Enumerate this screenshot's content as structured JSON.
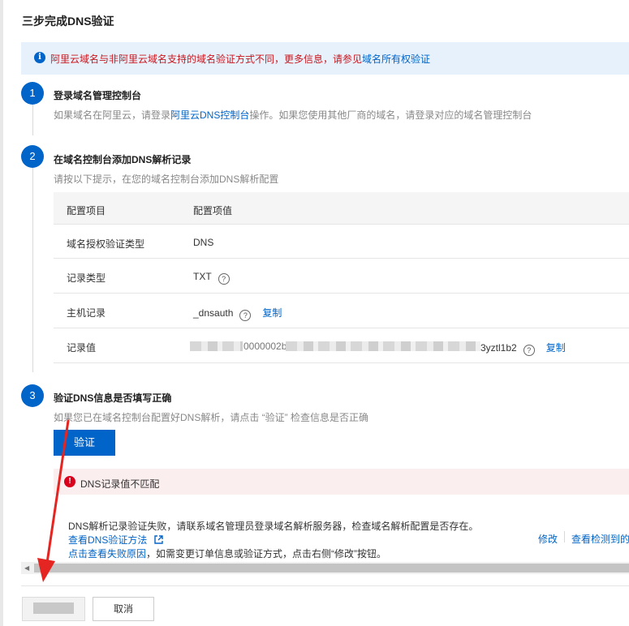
{
  "dialog": {
    "title": "三步完成DNS验证"
  },
  "notice": {
    "text": "阿里云域名与非阿里云域名支持的域名验证方式不同，更多信息，请参见",
    "link": "域名所有权验证"
  },
  "steps": [
    {
      "number": "1",
      "title": "登录域名管理控制台",
      "desc_prefix": "如果域名在阿里云，请登录",
      "desc_link": "阿里云DNS控制台",
      "desc_suffix": "操作。如果您使用其他厂商的域名，请登录对应的域名管理控制台"
    },
    {
      "number": "2",
      "title": "在域名控制台添加DNS解析记录",
      "desc": "请按以下提示，在您的域名控制台添加DNS解析配置"
    },
    {
      "number": "3",
      "title": "验证DNS信息是否填写正确",
      "desc": "如果您已在域名控制台配置好DNS解析，请点击 “验证” 检查信息是否正确"
    }
  ],
  "table": {
    "headers": [
      "配置项目",
      "配置项值"
    ],
    "rows": [
      {
        "label": "域名授权验证类型",
        "value": "DNS"
      },
      {
        "label": "记录类型",
        "value": "TXT"
      },
      {
        "label": "主机记录",
        "value": "_dnsauth",
        "action": "复制"
      },
      {
        "label": "记录值",
        "value_visible_start": "0000002b",
        "value_visible_end": "3yztl1b2",
        "action": "复制"
      }
    ],
    "help_icon": "question-circle-icon"
  },
  "verify_button": "验证",
  "error": {
    "icon": "error-circle-icon",
    "text": "DNS记录值不匹配",
    "detail": "DNS解析记录验证失败，请联系域名管理员登录域名解析服务器，检查域名解析配置是否存在。",
    "doc_link": "查看DNS验证方法",
    "reason_link": "点击查看失败原因",
    "reason_suffix": "，如需变更订单信息或验证方式，点击右侧“修改”按钮。",
    "modify": "修改",
    "check_link": "查看检测到的"
  },
  "footer": {
    "cancel": "取消"
  },
  "colors": {
    "primary": "#0064c8",
    "danger": "#d9001b",
    "annotation": "#e52521"
  }
}
